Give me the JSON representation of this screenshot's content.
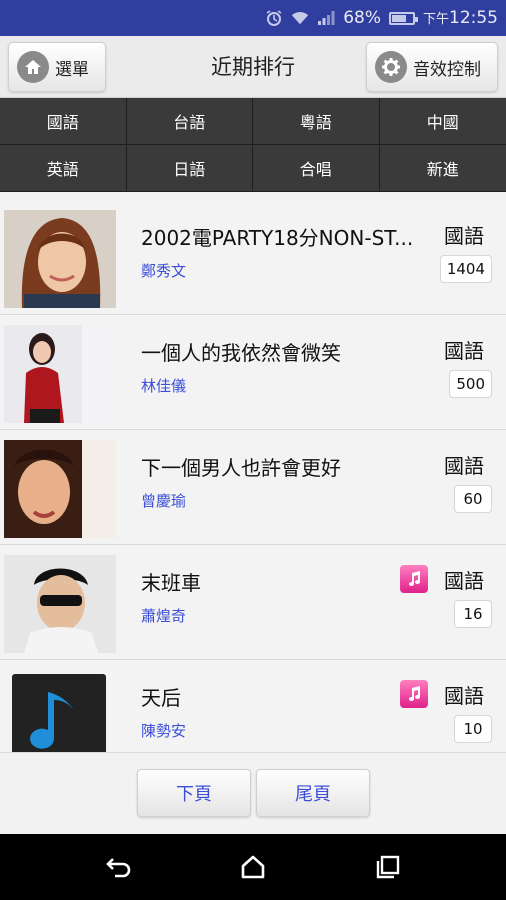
{
  "status_bar": {
    "battery_percent": "68%",
    "time_prefix": "下午",
    "time": "12:55",
    "battery_level": 0.68,
    "icons": [
      "alarm-icon",
      "wifi-icon",
      "signal-icon",
      "battery-icon"
    ]
  },
  "header": {
    "menu_label": "選單",
    "title": "近期排行",
    "effects_label": "音效控制"
  },
  "categories": [
    "國語",
    "台語",
    "粵語",
    "中國",
    "英語",
    "日語",
    "合唱",
    "新進"
  ],
  "songs": [
    {
      "title": "2002電PARTY18分NON-ST...",
      "artist": "鄭秀文",
      "language": "國語",
      "count": "1404",
      "has_music_icon": false
    },
    {
      "title": "一個人的我依然會微笑",
      "artist": "林佳儀",
      "language": "國語",
      "count": "500",
      "has_music_icon": false
    },
    {
      "title": "下一個男人也許會更好",
      "artist": "曾慶瑜",
      "language": "國語",
      "count": "60",
      "has_music_icon": false
    },
    {
      "title": "末班車",
      "artist": "蕭煌奇",
      "language": "國語",
      "count": "16",
      "has_music_icon": true
    },
    {
      "title": "天后",
      "artist": "陳勢安",
      "language": "國語",
      "count": "10",
      "has_music_icon": true
    }
  ],
  "pager": {
    "next_label": "下頁",
    "last_label": "尾頁"
  },
  "colors": {
    "status_bar": "#303f9f",
    "accent_link": "#3b4fd8",
    "category_bg": "#3a3a3a",
    "music_icon": "#e0218a"
  }
}
